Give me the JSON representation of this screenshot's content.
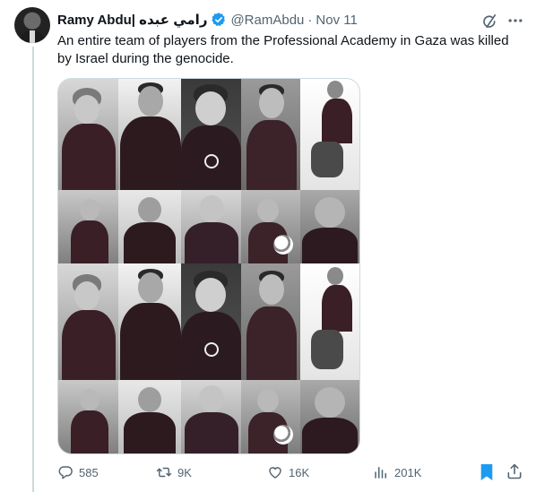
{
  "post": {
    "author_name": "Ramy Abdu| رامي عبده",
    "handle": "@RamAbdu",
    "separator": "·",
    "date": "Nov 11",
    "text": "An entire team of players from the Professional Academy in Gaza was killed by Israel during the genocide."
  },
  "stats": {
    "replies": "585",
    "reposts": "9K",
    "likes": "16K",
    "views": "201K"
  },
  "colors": {
    "verified": "#1d9bf0",
    "bookmark_active": "#1d9bf0",
    "muted_text": "#536471"
  },
  "icons": [
    "verified-badge-icon",
    "grok-icon",
    "more-icon",
    "reply-icon",
    "repost-icon",
    "like-icon",
    "views-icon",
    "bookmark-icon",
    "share-icon"
  ]
}
